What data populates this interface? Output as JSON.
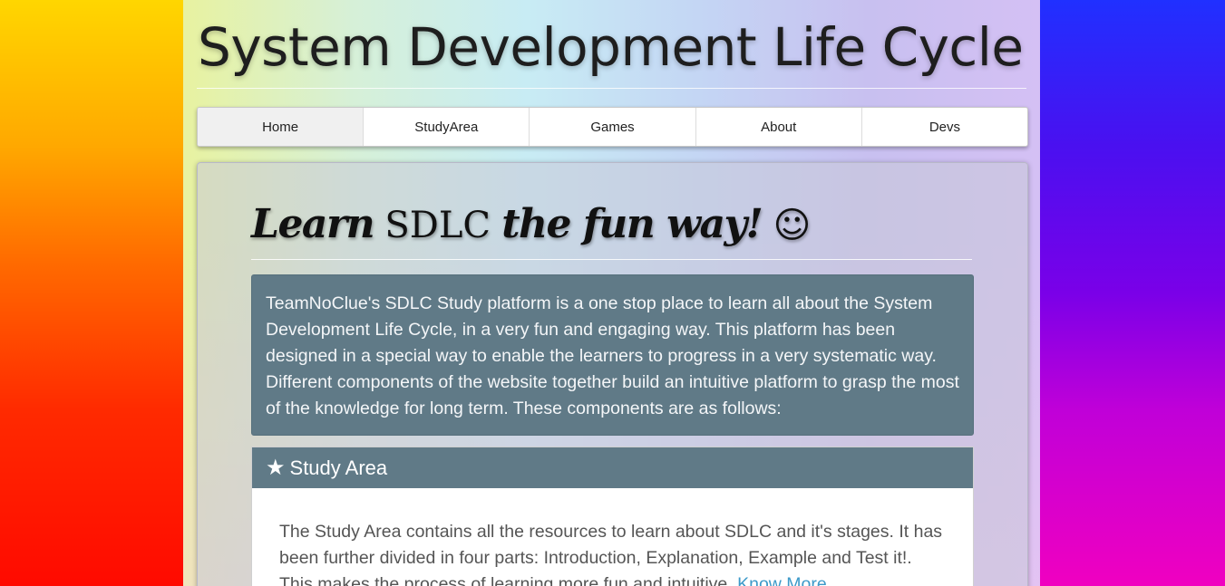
{
  "site": {
    "title": "System Development Life Cycle"
  },
  "nav": {
    "items": [
      {
        "label": "Home",
        "active": true
      },
      {
        "label": "StudyArea",
        "active": false
      },
      {
        "label": "Games",
        "active": false
      },
      {
        "label": "About",
        "active": false
      },
      {
        "label": "Devs",
        "active": false
      }
    ]
  },
  "hero": {
    "tagline_part1": "Learn",
    "tagline_part2": "SDLC",
    "tagline_part3": "the fun way!",
    "smiley": "☺"
  },
  "intro": {
    "text": "TeamNoClue's SDLC Study platform is a one stop place to learn all about the System Development Life Cycle, in a very fun and engaging way. This platform has been designed in a special way to enable the learners to progress in a very systematic way. Different components of the website together build an intuitive platform to grasp the most of the knowledge for long term. These components are as follows:"
  },
  "study_area_panel": {
    "icon": "star-icon",
    "title": "Study Area",
    "body": "The Study Area contains all the resources to learn about SDLC and it's stages. It has been further divided in four parts: Introduction, Explanation, Example and Test it!. This makes the process of learning more fun and intuitive.",
    "link_label": "Know More..."
  },
  "colors": {
    "panel_header": "#607a87",
    "link": "#3d9ac9"
  }
}
